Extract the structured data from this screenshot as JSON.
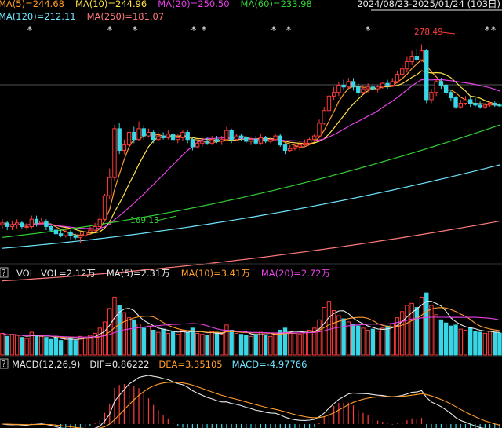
{
  "price_panel": {
    "range": "2024/08/23-2025/01/24 (103日)",
    "ma_row1": [
      {
        "label": "MA(5)=244.68",
        "color": "#ff9c2a"
      },
      {
        "label": "MA(10)=244.96",
        "color": "#ffe14a"
      },
      {
        "label": "MA(20)=250.50",
        "color": "#e640e6"
      },
      {
        "label": "MA(60)=233.98",
        "color": "#35d035"
      }
    ],
    "ma_row2": [
      {
        "label": "MA(120)=212.11",
        "color": "#6fe6ff"
      },
      {
        "label": "MA(250)=181.07",
        "color": "#ff7a7a"
      }
    ],
    "high_label": "278.49",
    "low_label": "169.13",
    "star": "*"
  },
  "vol_panel": {
    "help": "?",
    "name": "VOL",
    "labels": [
      {
        "label": "VOL=2.12万",
        "color": "#e8e8e8"
      },
      {
        "label": "MA(5)=2.31万",
        "color": "#e8e8e8"
      },
      {
        "label": "MA(10)=3.41万",
        "color": "#ff9c2a"
      },
      {
        "label": "MA(20)=2.72万",
        "color": "#e640e6"
      }
    ]
  },
  "macd_panel": {
    "help": "?",
    "labels": [
      {
        "label": "MACD(12,26,9)",
        "color": "#e8e8e8"
      },
      {
        "label": "DIF=0.86222",
        "color": "#e8e8e8"
      },
      {
        "label": "DEA=3.35105",
        "color": "#ff9c2a"
      },
      {
        "label": "MACD=-4.97766",
        "color": "#6fe6ff"
      }
    ]
  },
  "colors": {
    "up": "#ff3b3b",
    "down": "#39d6e6",
    "background": "#000000"
  },
  "chart_data": {
    "type": "candlestick",
    "period": "2024/08/23-2025/01/24",
    "days": 103,
    "ylim": [
      160,
      290
    ],
    "high": 278.49,
    "low": 169.13,
    "candles": [
      [
        179,
        180,
        177,
        182
      ],
      [
        180,
        178,
        176,
        181
      ],
      [
        178,
        179,
        176,
        181
      ],
      [
        179,
        180,
        177,
        182
      ],
      [
        180,
        178,
        177,
        181
      ],
      [
        178,
        178,
        176,
        180
      ],
      [
        178,
        182,
        177,
        184
      ],
      [
        182,
        180,
        178,
        184
      ],
      [
        180,
        181,
        179,
        183
      ],
      [
        181,
        178,
        176,
        182
      ],
      [
        178,
        176,
        175,
        179
      ],
      [
        176,
        174,
        173,
        177
      ],
      [
        174,
        173,
        172,
        176
      ],
      [
        173,
        175,
        172,
        177
      ],
      [
        175,
        173,
        171,
        176
      ],
      [
        173,
        172,
        171,
        174
      ],
      [
        172,
        173,
        169.13,
        175
      ],
      [
        173,
        175,
        172,
        176
      ],
      [
        175,
        176,
        174,
        178
      ],
      [
        176,
        178,
        175,
        180
      ],
      [
        178,
        182,
        177,
        185
      ],
      [
        182,
        195,
        181,
        196
      ],
      [
        195,
        205,
        193,
        210
      ],
      [
        205,
        232,
        203,
        234
      ],
      [
        232,
        220,
        218,
        235
      ],
      [
        220,
        223,
        218,
        226
      ],
      [
        223,
        230,
        221,
        232
      ],
      [
        230,
        226,
        224,
        233
      ],
      [
        226,
        232,
        225,
        236
      ],
      [
        232,
        228,
        226,
        234
      ],
      [
        228,
        230,
        227,
        232
      ],
      [
        230,
        226,
        224,
        231
      ],
      [
        226,
        228,
        225,
        230
      ],
      [
        228,
        227,
        226,
        230
      ],
      [
        227,
        229,
        226,
        231
      ],
      [
        229,
        226,
        225,
        231
      ],
      [
        226,
        227,
        224,
        229
      ],
      [
        227,
        230,
        225,
        231
      ],
      [
        230,
        226,
        224,
        231
      ],
      [
        226,
        222,
        220,
        227
      ],
      [
        222,
        224,
        221,
        226
      ],
      [
        224,
        225,
        222,
        227
      ],
      [
        225,
        224,
        223,
        227
      ],
      [
        224,
        226,
        223,
        228
      ],
      [
        226,
        225,
        224,
        228
      ],
      [
        225,
        226,
        223,
        228
      ],
      [
        226,
        231,
        225,
        233
      ],
      [
        231,
        226,
        224,
        232
      ],
      [
        226,
        228,
        225,
        229
      ],
      [
        228,
        227,
        225,
        229
      ],
      [
        227,
        225,
        224,
        228
      ],
      [
        225,
        226,
        223,
        227
      ],
      [
        226,
        224,
        223,
        228
      ],
      [
        224,
        227,
        223,
        229
      ],
      [
        227,
        225,
        224,
        228
      ],
      [
        225,
        226,
        224,
        227
      ],
      [
        226,
        228,
        225,
        229
      ],
      [
        228,
        223,
        222,
        229
      ],
      [
        223,
        220,
        218,
        224
      ],
      [
        220,
        221,
        219,
        223
      ],
      [
        221,
        222,
        220,
        223
      ],
      [
        222,
        223,
        220,
        225
      ],
      [
        223,
        224,
        222,
        226
      ],
      [
        224,
        226,
        223,
        227
      ],
      [
        226,
        228,
        225,
        229
      ],
      [
        228,
        235,
        227,
        237
      ],
      [
        235,
        242,
        234,
        244
      ],
      [
        242,
        250,
        240,
        253
      ],
      [
        250,
        252,
        248,
        255
      ],
      [
        252,
        256,
        250,
        258
      ],
      [
        256,
        255,
        253,
        259
      ],
      [
        255,
        258,
        254,
        260
      ],
      [
        258,
        255,
        253,
        260
      ],
      [
        255,
        252,
        250,
        257
      ],
      [
        252,
        254,
        251,
        256
      ],
      [
        254,
        255,
        252,
        257
      ],
      [
        255,
        254,
        253,
        257
      ],
      [
        254,
        255,
        252,
        256
      ],
      [
        255,
        257,
        254,
        258
      ],
      [
        257,
        256,
        254,
        259
      ],
      [
        256,
        258,
        255,
        260
      ],
      [
        258,
        262,
        257,
        264
      ],
      [
        262,
        265,
        260,
        268
      ],
      [
        265,
        269,
        263,
        272
      ],
      [
        269,
        272,
        267,
        275
      ],
      [
        272,
        270,
        268,
        276
      ],
      [
        270,
        275,
        269,
        278.49
      ],
      [
        275,
        248,
        246,
        276
      ],
      [
        248,
        252,
        246,
        254
      ],
      [
        252,
        258,
        250,
        259
      ],
      [
        258,
        256,
        254,
        260
      ],
      [
        256,
        252,
        250,
        257
      ],
      [
        252,
        249,
        247,
        253
      ],
      [
        249,
        244,
        243,
        250
      ],
      [
        244,
        246,
        243,
        248
      ],
      [
        246,
        248,
        245,
        250
      ],
      [
        248,
        246,
        244,
        250
      ],
      [
        246,
        245,
        244,
        249
      ],
      [
        245,
        244,
        243,
        247
      ],
      [
        244,
        245,
        243,
        246
      ],
      [
        245,
        246,
        244,
        247
      ],
      [
        246,
        245,
        244,
        247
      ],
      [
        245,
        244.68,
        244,
        246
      ]
    ],
    "moving_averages": [
      "MA(5)",
      "MA(10)",
      "MA(20)",
      "MA(60)",
      "MA(120)",
      "MA(250)"
    ],
    "volume": [
      2.1,
      1.8,
      2.0,
      1.9,
      1.7,
      1.6,
      2.2,
      1.9,
      1.8,
      1.7,
      1.5,
      1.6,
      1.4,
      1.5,
      1.6,
      1.4,
      1.8,
      1.7,
      1.9,
      2.1,
      2.6,
      3.2,
      4.5,
      5.6,
      4.8,
      4.1,
      3.6,
      3.4,
      3.0,
      2.6,
      2.8,
      2.4,
      2.2,
      2.5,
      2.1,
      2.3,
      2.0,
      2.4,
      2.2,
      2.6,
      2.1,
      2.0,
      1.9,
      2.3,
      2.2,
      2.0,
      2.9,
      2.4,
      2.1,
      2.0,
      1.9,
      1.8,
      2.0,
      2.2,
      1.9,
      1.8,
      2.1,
      2.4,
      2.6,
      2.2,
      2.1,
      2.0,
      2.2,
      2.4,
      2.6,
      3.4,
      4.6,
      5.2,
      4.3,
      3.8,
      3.5,
      3.2,
      3.0,
      2.8,
      2.6,
      2.4,
      2.5,
      2.3,
      2.6,
      2.8,
      3.0,
      3.6,
      4.2,
      4.8,
      5.0,
      4.6,
      5.6,
      6.0,
      4.8,
      3.9,
      3.4,
      3.1,
      2.8,
      2.9,
      2.5,
      2.4,
      2.6,
      2.3,
      2.2,
      2.1,
      2.3,
      2.2,
      2.12
    ],
    "macd": {
      "dif": 0.86222,
      "dea": 3.35105,
      "macd": -4.97766
    }
  }
}
